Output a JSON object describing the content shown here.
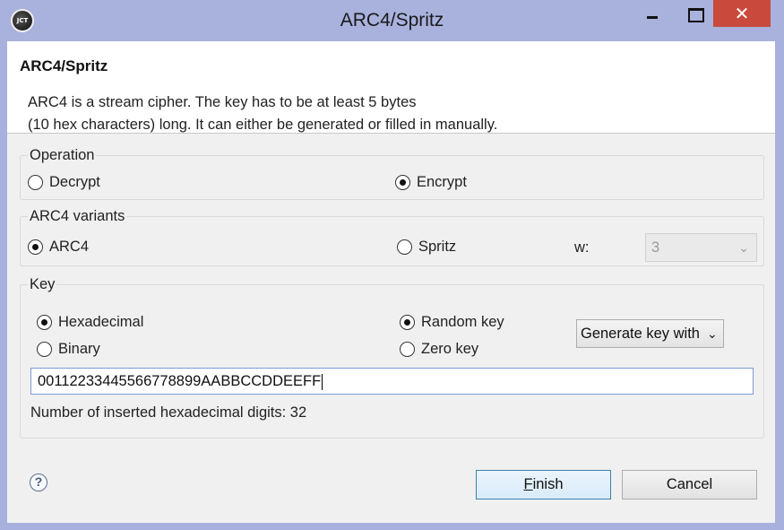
{
  "window": {
    "title": "ARC4/Spritz",
    "app_icon": "jct-logo-icon"
  },
  "header": {
    "title": "ARC4/Spritz",
    "description_line1": "ARC4 is a stream cipher. The key has to be at least 5 bytes",
    "description_line2": "(10 hex characters) long. It can either be generated or filled in manually."
  },
  "operation": {
    "label": "Operation",
    "decrypt_label": "Decrypt",
    "encrypt_label": "Encrypt",
    "selected": "Encrypt"
  },
  "variants": {
    "label": "ARC4 variants",
    "arc4_label": "ARC4",
    "spritz_label": "Spritz",
    "selected": "ARC4",
    "w_label": "w:",
    "w_value": "3"
  },
  "key": {
    "label": "Key",
    "hex_label": "Hexadecimal",
    "binary_label": "Binary",
    "format_selected": "Hexadecimal",
    "random_label": "Random key",
    "zero_label": "Zero key",
    "source_selected": "Random key",
    "generate_label": "Generate key with",
    "value": "00112233445566778899AABBCCDDEEFF",
    "digit_count_text": "Number of inserted hexadecimal digits: 32"
  },
  "footer": {
    "finish_label_prefix": "",
    "finish_mnemonic": "F",
    "finish_label_rest": "inish",
    "cancel_label": "Cancel"
  },
  "colors": {
    "titlebar": "#a9b1dd",
    "close_button": "#c94a3c",
    "dialog_bg": "#f0f0f0",
    "default_button_border": "#3c7fb1"
  }
}
